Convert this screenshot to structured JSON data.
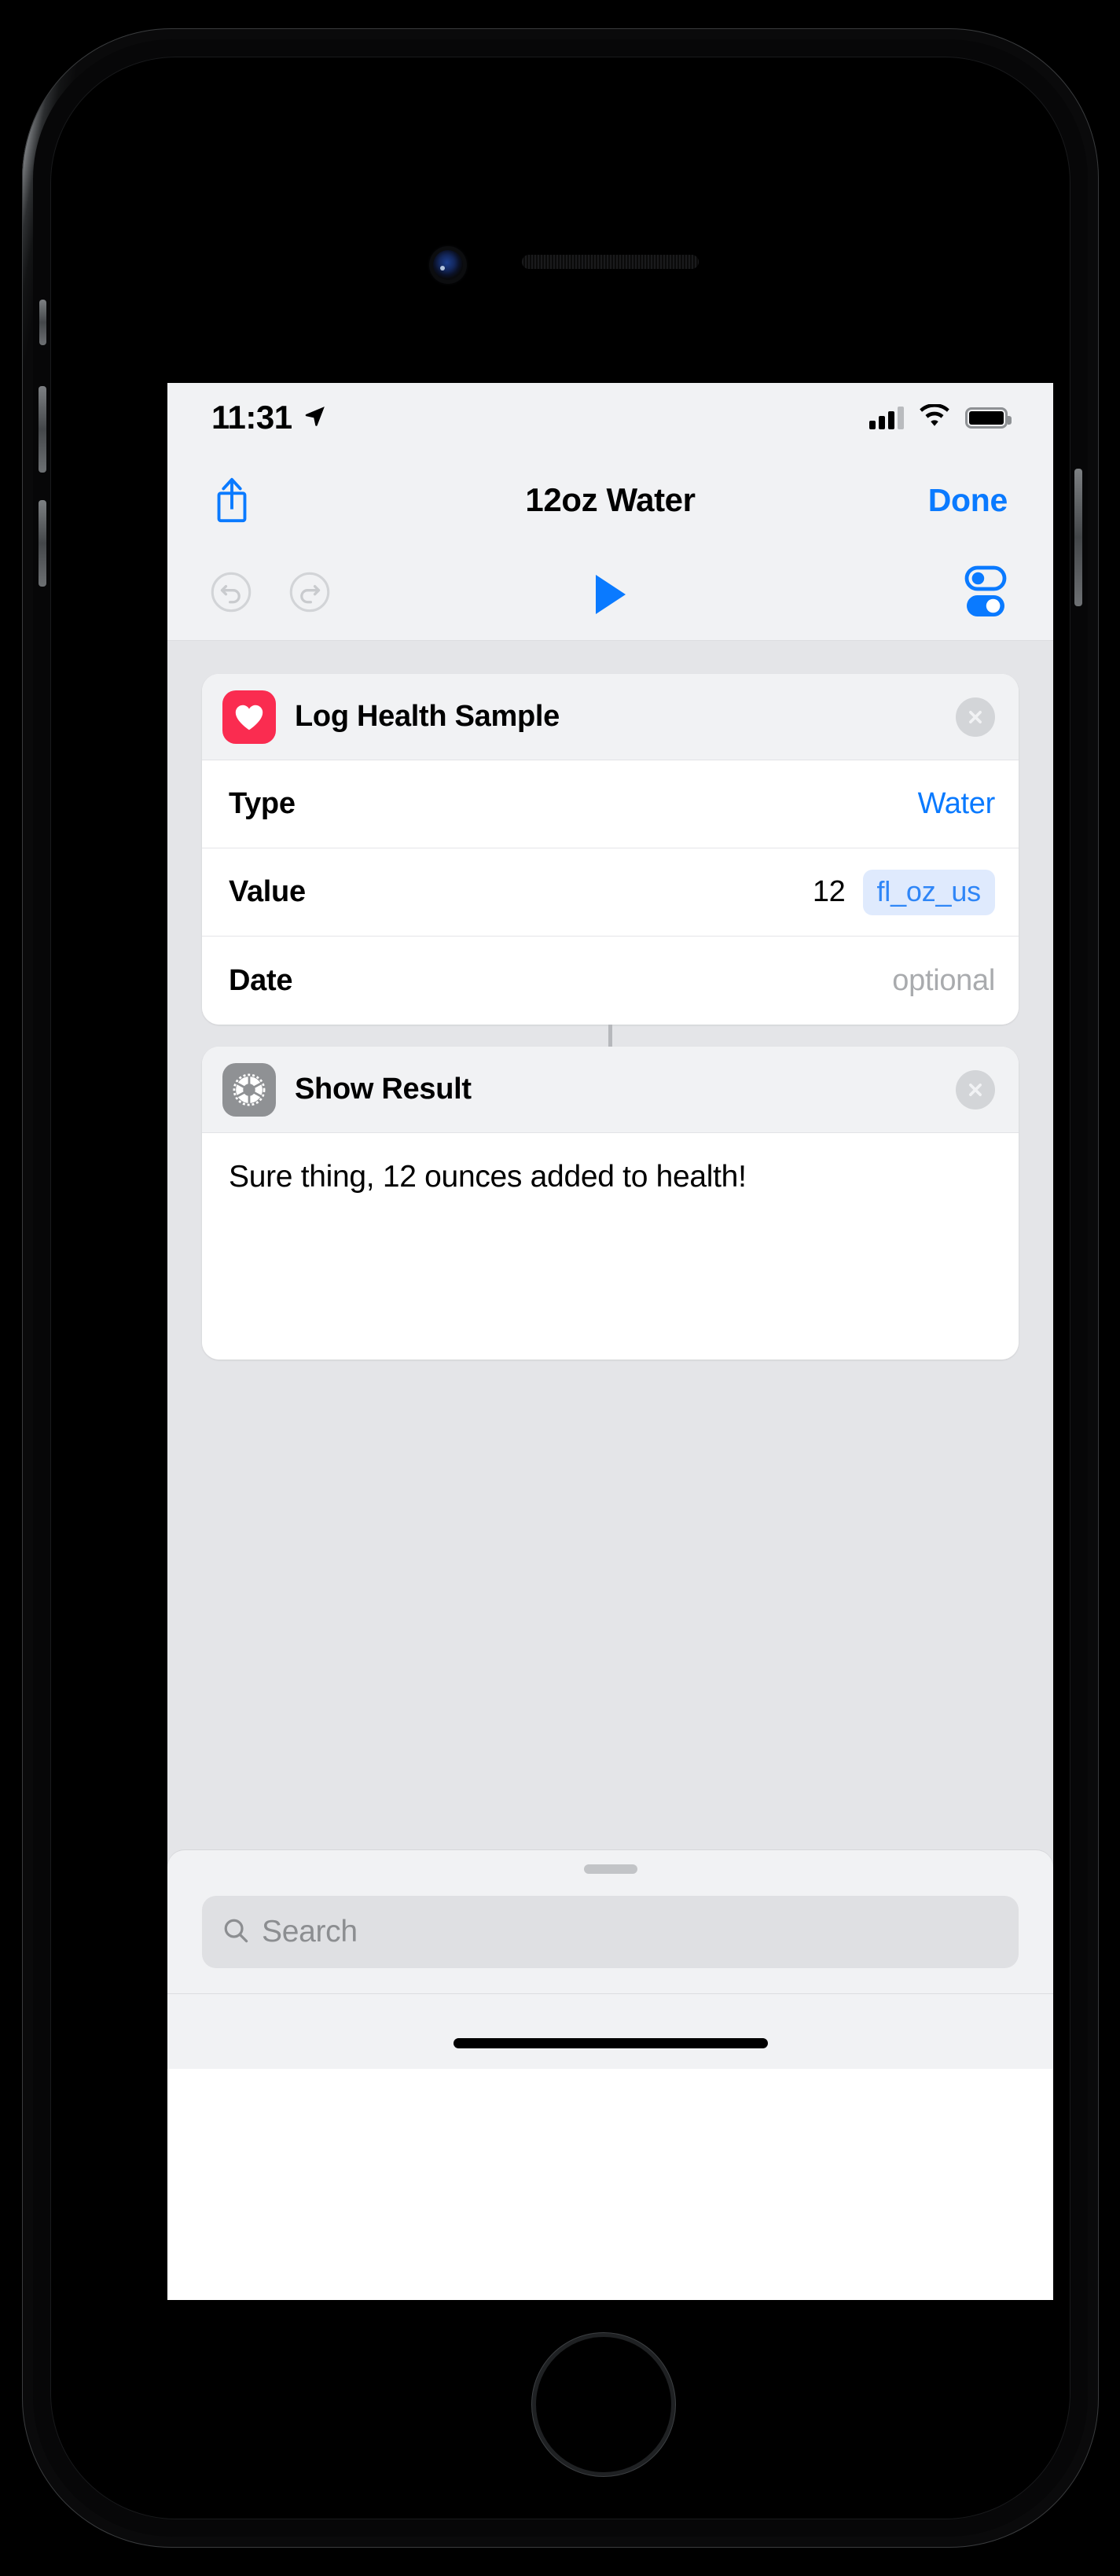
{
  "status_bar": {
    "time": "11:31",
    "location_icon": "location-arrow-icon",
    "signal_icon": "cellular-signal-icon",
    "wifi_icon": "wifi-icon",
    "battery_icon": "battery-full-icon"
  },
  "nav_bar": {
    "share_icon": "share-icon",
    "title": "12oz Water",
    "done_label": "Done"
  },
  "toolbar": {
    "undo_icon": "undo-icon",
    "redo_icon": "redo-icon",
    "play_icon": "play-icon",
    "settings_icon": "toggles-settings-icon"
  },
  "actions": [
    {
      "icon": "heart-icon",
      "icon_color": "#fa2c50",
      "title": "Log Health Sample",
      "close_icon": "close-circle-icon",
      "params": [
        {
          "label": "Type",
          "value": "Water",
          "value_style": "link",
          "token": null
        },
        {
          "label": "Value",
          "value": "12",
          "value_style": "plain",
          "token": "fl_oz_us"
        },
        {
          "label": "Date",
          "value": "optional",
          "value_style": "muted",
          "token": null
        }
      ]
    },
    {
      "icon": "gear-icon",
      "icon_color": "#8f9194",
      "title": "Show Result",
      "close_icon": "close-circle-icon",
      "body_text": "Sure thing, 12 ounces added to health!"
    }
  ],
  "bottom_sheet": {
    "grabber": "sheet-grabber",
    "search_icon": "search-icon",
    "search_placeholder": "Search",
    "search_value": ""
  },
  "colors": {
    "accent_blue": "#0a7aff",
    "token_blue": "#2f86f7",
    "token_bg": "#dfeafd",
    "health_red": "#fa2c50",
    "gear_gray": "#8f9194",
    "canvas_bg": "#e4e5e8",
    "chrome_bg": "#f1f2f4"
  }
}
